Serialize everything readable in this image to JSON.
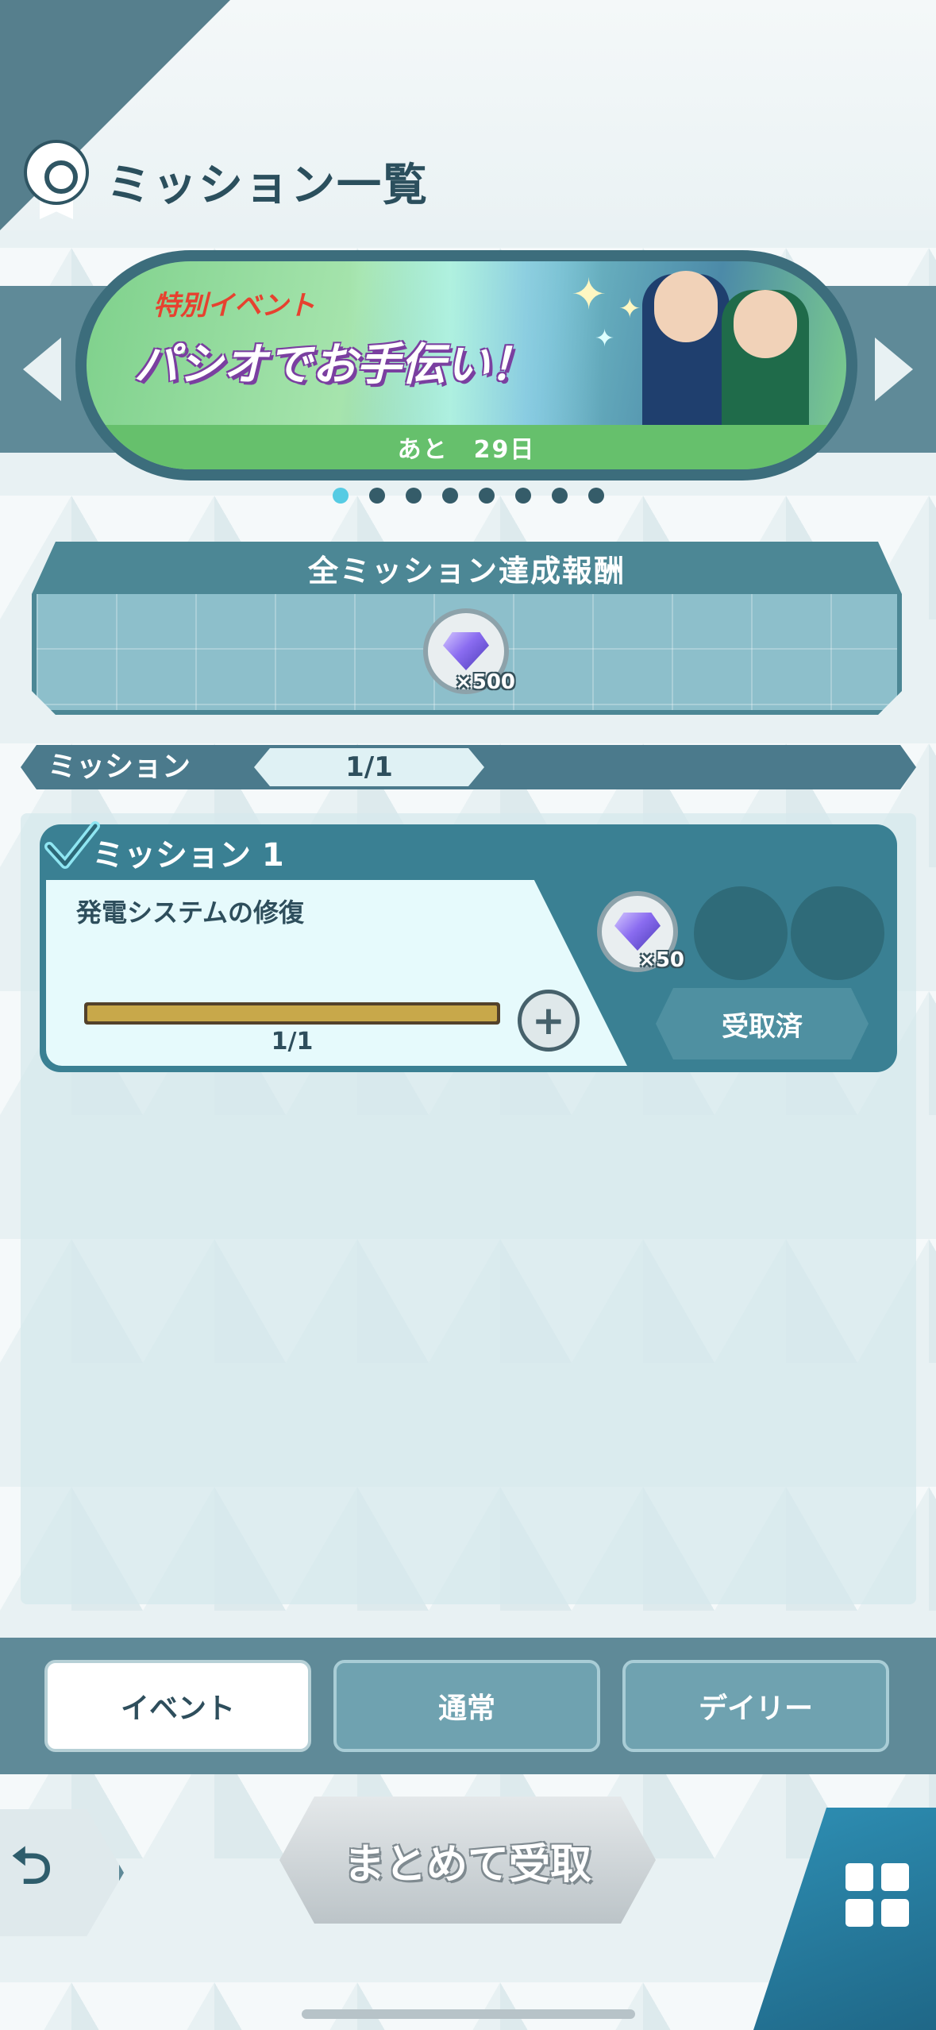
{
  "header": {
    "title": "ミッション一覧"
  },
  "banner": {
    "tag": "特別イベント",
    "event_name": "パシオでお手伝い！",
    "remaining": "あと　29日",
    "page_count": 8,
    "active_page": 1
  },
  "all_reward": {
    "title": "全ミッション達成報酬",
    "reward_qty": "×500"
  },
  "mission_bar": {
    "label": "ミッション",
    "count": "1/1"
  },
  "missions": [
    {
      "name": "ミッション 1",
      "description": "発電システムの修復",
      "progress_text": "1/1",
      "progress_fraction": 1.0,
      "reward_qty": "×50",
      "status_label": "受取済"
    }
  ],
  "tabs": [
    {
      "label": "イベント",
      "active": true
    },
    {
      "label": "通常",
      "active": false
    },
    {
      "label": "デイリー",
      "active": false
    }
  ],
  "bottom": {
    "collect_all_label": "まとめて受取"
  },
  "colors": {
    "accent": "#4c8795",
    "dot_active": "#56cbe3",
    "event_tag": "#e7412f"
  },
  "icons": {
    "back": "back-arrow-icon",
    "menu": "grid-menu-icon",
    "medal": "medal-icon",
    "gem": "gem-icon",
    "plus": "plus-icon",
    "check": "check-icon"
  }
}
